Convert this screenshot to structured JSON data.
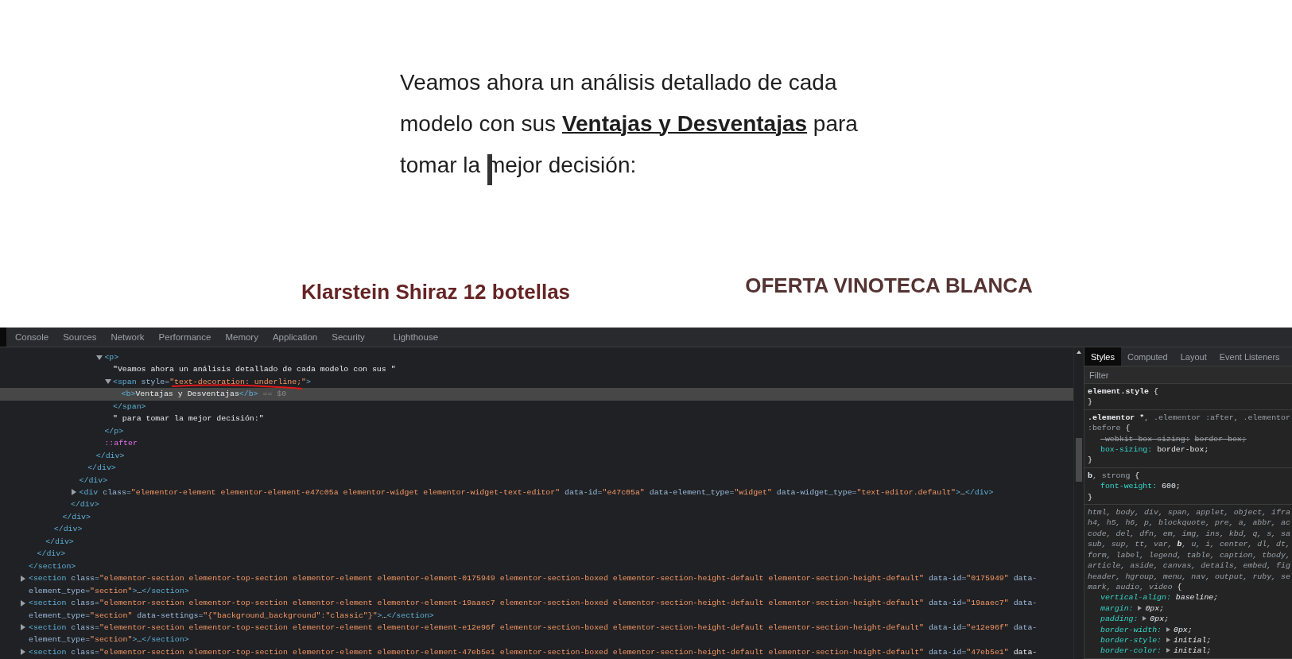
{
  "page": {
    "paragraph": {
      "text": "Veamos ahora un análisis detallado de cada modelo con sus **Ventajas y Desventajas** para tomar la mejor decisión:",
      "cursor": true
    },
    "products": [
      {
        "title": "Klarstein Shiraz 12 botellas"
      },
      {
        "title": "OFERTA VINOTECA BLANCA"
      }
    ]
  },
  "devtools": {
    "tabs": [
      {
        "label": "Console",
        "selected": false
      },
      {
        "label": "Sources",
        "selected": false
      },
      {
        "label": "Network",
        "selected": false
      },
      {
        "label": "Performance",
        "selected": false
      },
      {
        "label": "Memory",
        "selected": false
      },
      {
        "label": "Application",
        "selected": false
      },
      {
        "label": "Security",
        "selected": false
      },
      {
        "label": "Lighthouse",
        "selected": false
      }
    ],
    "dom_tree": [
      {
        "kind": "element",
        "close": "</section>",
        "expanded": true,
        "selected": false,
        "children": [
          {
            "kind": "element",
            "close": "</div>",
            "expanded": true,
            "selected": false,
            "children": [
              {
                "kind": "element",
                "close": "</div>",
                "expanded": true,
                "selected": false,
                "children": [
                  {
                    "kind": "element",
                    "close": "</div>",
                    "expanded": true,
                    "selected": false,
                    "children": [
                      {
                        "kind": "element",
                        "close": "</div>",
                        "expanded": true,
                        "selected": false,
                        "children": [
                          {
                            "kind": "element",
                            "close": "</div>",
                            "expanded": true,
                            "selected": false,
                            "children": [
                              {
                                "kind": "element",
                                "close": "</div>",
                                "expanded": true,
                                "selected": false,
                                "children": [
                                  {
                                    "kind": "element",
                                    "close": "</div>",
                                    "expanded": true,
                                    "selected": false,
                                    "children": [
                                      {
                                        "kind": "element",
                                        "close": "</div>",
                                        "expanded": true,
                                        "selected": false,
                                        "children": [
                                          {
                                            "kind": "element",
                                            "open": "<p>",
                                            "close": "</p>",
                                            "expanded": true,
                                            "selected": false,
                                            "children": [
                                              {
                                                "kind": "text",
                                                "text": "\"Veamos ahora un análisis detallado de cada modelo con sus \"",
                                                "selected": false
                                              },
                                              {
                                                "kind": "element",
                                                "open": "<span style=\"text-decoration: underline;\">",
                                                "close": "</span>",
                                                "expanded": true,
                                                "selected": false,
                                                "annotated": true,
                                                "children": [
                                                  {
                                                    "kind": "element",
                                                    "open": "<b>Ventajas y Desventajas</b>",
                                                    "selected": true,
                                                    "marker": "== $0"
                                                  }
                                                ]
                                              },
                                              {
                                                "kind": "text",
                                                "text": "\" para tomar la mejor decisión:\"",
                                                "selected": false
                                              }
                                            ]
                                          },
                                          {
                                            "kind": "pseudo",
                                            "text": "::after",
                                            "selected": false
                                          }
                                        ]
                                      }
                                    ]
                                  }
                                ]
                              },
                              {
                                "kind": "element",
                                "open": "<div class=\"elementor-element elementor-element-e47c05a elementor-widget elementor-widget-text-editor\" data-id=\"e47c05a\" data-element_type=\"widget\" data-widget_type=\"text-editor.default\">…</div>",
                                "expanded": false,
                                "selected": false
                              }
                            ]
                          }
                        ]
                      }
                    ]
                  }
                ]
              }
            ]
          }
        ]
      },
      {
        "kind": "element",
        "open": "<section class=\"elementor-section elementor-top-section elementor-element elementor-element-0175949 elementor-section-boxed elementor-section-height-default elementor-section-height-default\" data-id=\"0175949\" data-element_type=\"section\">…</section>",
        "expanded": false,
        "selected": false
      },
      {
        "kind": "element",
        "open": "<section class=\"elementor-section elementor-top-section elementor-element elementor-element-19aaec7 elementor-section-boxed elementor-section-height-default elementor-section-height-default\" data-id=\"19aaec7\" data-element_type=\"section\" data-settings=\"{\"background_background\":\"classic\"}\">…</section>",
        "expanded": false,
        "selected": false
      },
      {
        "kind": "element",
        "open": "<section class=\"elementor-section elementor-top-section elementor-element elementor-element-e12e96f elementor-section-boxed elementor-section-height-default elementor-section-height-default\" data-id=\"e12e96f\" data-element_type=\"section\">…</section>",
        "expanded": false,
        "selected": false
      },
      {
        "kind": "element",
        "open": "<section class=\"elementor-section elementor-top-section elementor-element elementor-element-47eb5e1 elementor-section-boxed elementor-section-height-default elementor-section-height-default\" data-id=\"47eb5e1\" data-",
        "expanded": false,
        "selected": false
      }
    ],
    "sidebar": {
      "tabs": [
        {
          "label": "Styles",
          "selected": true
        },
        {
          "label": "Computed",
          "selected": false
        },
        {
          "label": "Layout",
          "selected": false
        },
        {
          "label": "Event Listeners",
          "selected": false
        }
      ],
      "filter": {
        "placeholder": "Filter"
      },
      "rules": [
        {
          "kind": "editable",
          "selector": [
            {
              "text": "element.style",
              "matched": true
            }
          ],
          "open": "{",
          "close": "}"
        },
        {
          "kind": "editable",
          "selector": [
            {
              "text": ".elementor *",
              "matched": true
            },
            {
              "text": ", .elementor :after, .elementor\n:before",
              "matched": false
            }
          ],
          "open": "{",
          "close": "}",
          "properties": [
            {
              "text": "-webkit-box-sizing: border-box;",
              "overridden": true,
              "expandable": false
            },
            {
              "text": "box-sizing: border-box;",
              "overridden": false,
              "expandable": false
            }
          ]
        },
        {
          "kind": "editable",
          "selector": [
            {
              "text": "b",
              "matched": true
            },
            {
              "text": ", strong",
              "matched": false
            }
          ],
          "open": "{",
          "close": "}",
          "properties": [
            {
              "text": "font-weight: 600;",
              "overridden": false,
              "expandable": false
            }
          ]
        },
        {
          "kind": "readonly",
          "selector": [
            {
              "text": "html, body, div, span, applet, object, ifra\nh4, h5, h6, p, blockquote, pre, a, abbr, ac\ncode, del, dfn, em, img, ins, kbd, q, s, sa\nsub, sup, tt, var, ",
              "matched": false
            },
            {
              "text": "b",
              "matched": true
            },
            {
              "text": ", u, i, center, dl, dt,\nform, label, legend, table, caption, tbody,\narticle, aside, canvas, details, embed, fig\nheader, hgroup, menu, nav, output, ruby, se\nmark, audio, video",
              "matched": false
            }
          ],
          "open": "{",
          "properties": [
            {
              "text": "vertical-align: baseline;",
              "overridden": false,
              "expandable": false
            },
            {
              "text": "margin: 0px;",
              "overridden": false,
              "expandable": true
            },
            {
              "text": "padding: 0px;",
              "overridden": false,
              "expandable": true
            },
            {
              "text": "border-width: 0px;",
              "overridden": false,
              "expandable": true
            },
            {
              "text": "border-style: initial;",
              "overridden": false,
              "expandable": true
            },
            {
              "text": "border-color: initial;",
              "overridden": false,
              "expandable": true
            }
          ]
        }
      ]
    }
  }
}
